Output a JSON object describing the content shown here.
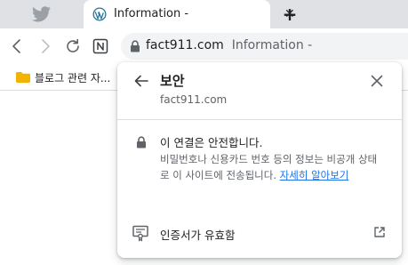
{
  "tabs": {
    "inactive_icon": "bird-logo-icon",
    "active": {
      "favicon": "wordpress-icon",
      "title": "Information -",
      "close_icon": "close-icon"
    },
    "new_tab_label": "+"
  },
  "toolbar": {
    "back_icon": "arrow-left-icon",
    "forward_icon": "arrow-right-icon",
    "reload_icon": "reload-icon",
    "extension_icon": "n-box-icon",
    "omnibox": {
      "lock_icon": "lock-icon",
      "domain": "fact911.com",
      "page_title": "Information -"
    }
  },
  "bookmarks": {
    "items": [
      {
        "icon": "folder-icon",
        "label": "블로그 관련 자..."
      }
    ]
  },
  "security_popup": {
    "title": "보안",
    "domain": "fact911.com",
    "connection": {
      "heading": "이 연결은 안전합니다.",
      "body": "비밀번호나 신용카드 번호 등의 정보는 비공개 상태로 이 사이트에 전송됩니다.",
      "learn_more": "자세히 알아보기"
    },
    "certificate_label": "인증서가 유효함",
    "colors": {
      "link": "#1a73e8",
      "secondary_text": "#5f6368",
      "folder": "#f2b400"
    }
  }
}
